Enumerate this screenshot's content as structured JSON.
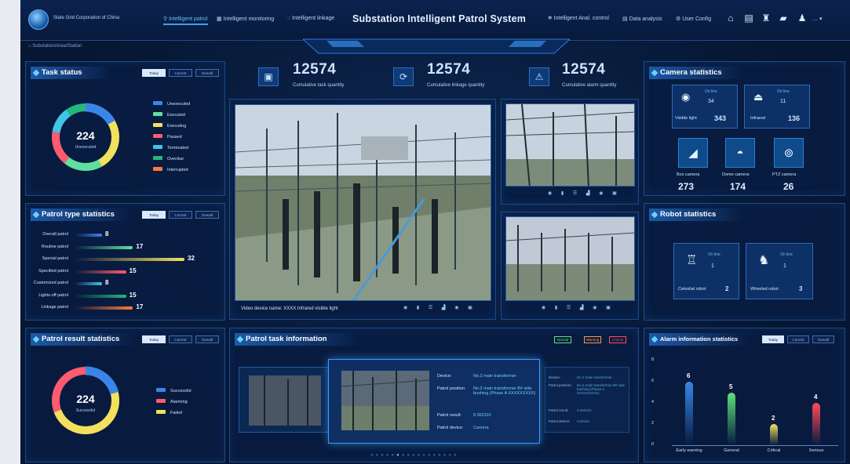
{
  "header": {
    "org": "State Grid Corporation of China",
    "system_title": "Substation Intelligent Patrol System",
    "user": "…",
    "nav_left": [
      {
        "label": "Intelligent patrol",
        "active": true
      },
      {
        "label": "Intelligent monitoring",
        "active": false
      },
      {
        "label": "Intelligent linkage",
        "active": false
      }
    ],
    "nav_right": [
      {
        "label": "Intelligent Anal. control"
      },
      {
        "label": "Data analysis"
      },
      {
        "label": "User Config"
      }
    ],
    "icons": [
      "home-icon",
      "document-icon",
      "robot-icon",
      "folder-icon",
      "user-icon"
    ]
  },
  "breadcrumb": "Substation/Area/Station",
  "task_status": {
    "title": "Task status",
    "tabs": [
      "Today",
      "Current",
      "Overall"
    ],
    "total": "224",
    "total_label": "Unexecuted",
    "legend": [
      {
        "label": "Unexecuted",
        "color": "#3a86e8"
      },
      {
        "label": "Executed",
        "color": "#5fe0a0"
      },
      {
        "label": "Executing",
        "color": "#f2e15c"
      },
      {
        "label": "Paused",
        "color": "#ff5a6e"
      },
      {
        "label": "Terminated",
        "color": "#3fc6e8"
      },
      {
        "label": "Overdue",
        "color": "#23b87a"
      },
      {
        "label": "Interrupted",
        "color": "#ff7a3c"
      }
    ]
  },
  "patrol_type": {
    "title": "Patrol type statistics",
    "tabs": [
      "Today",
      "Current",
      "Overall"
    ],
    "rows": [
      {
        "label": "Overall patrol",
        "value": 8,
        "color": "#3a86e8"
      },
      {
        "label": "Routine patrol",
        "value": 17,
        "color": "#5fe0a0"
      },
      {
        "label": "Special patrol",
        "value": 32,
        "color": "#f2e15c"
      },
      {
        "label": "Specified patrol",
        "value": 15,
        "color": "#ff5a6e"
      },
      {
        "label": "Customized patrol",
        "value": 8,
        "color": "#3fc6e8"
      },
      {
        "label": "Lights-off patrol",
        "value": 15,
        "color": "#23b87a"
      },
      {
        "label": "Linkage patrol",
        "value": 17,
        "color": "#ff7a3c"
      }
    ]
  },
  "patrol_result": {
    "title": "Patrol result statistics",
    "tabs": [
      "Today",
      "Current",
      "Overall"
    ],
    "total": "224",
    "total_label": "Successful",
    "legend": [
      {
        "label": "Successful",
        "color": "#3a86e8"
      },
      {
        "label": "Alarming",
        "color": "#ff5a6e"
      },
      {
        "label": "Failed",
        "color": "#f2e15c"
      }
    ]
  },
  "kpis": [
    {
      "value": "12574",
      "label": "Cumulative task quantity",
      "color": "#5fd8ff",
      "icon": "clipboard-icon"
    },
    {
      "value": "12574",
      "label": "Cumulative linkage quantity",
      "color": "#5fe07a",
      "icon": "refresh-icon"
    },
    {
      "value": "12574",
      "label": "Cumulative alarm quantity",
      "color": "#ff4a5a",
      "icon": "warning-icon"
    }
  ],
  "video": {
    "caption": "Video device name: XXXX Infrared visible light"
  },
  "patrol_task": {
    "title": "Patrol task information",
    "filters": [
      "Normal",
      "Warning",
      "Critical"
    ],
    "detail": {
      "device_k": "Device:",
      "device_v": "No.2 main transformer",
      "pos_k": "Patrol position:",
      "pos_v": "No.2 main transformer B# side bushing (Phase A XXXXXXXXX)",
      "result_k": "Patrol result:",
      "result_v": "0.352110",
      "pdev_k": "Patrol device:",
      "pdev_v": "Camera"
    },
    "detail2": {
      "device_k": "Device:",
      "device_v": "No.2 main transformer",
      "pos_k": "Patrol position:",
      "pos_v": "No.2 main transformer B# side bushing (Phase A XXXXXXXXX)",
      "result_k": "Patrol result:",
      "result_v": "0.352110",
      "pdev_k": "Patrol device:",
      "pdev_v": "Camera"
    }
  },
  "camera": {
    "title": "Camera statistics",
    "visible": {
      "label": "Visible light",
      "online_label": "On line",
      "online": "34",
      "total": "343"
    },
    "infrared": {
      "label": "Infrared",
      "online_label": "On line",
      "online": "11",
      "total": "136"
    },
    "types": [
      {
        "label": "Box camera",
        "value": "273",
        "icon": "box-camera-icon"
      },
      {
        "label": "Dome camera",
        "value": "174",
        "icon": "dome-camera-icon"
      },
      {
        "label": "PTZ camera",
        "value": "26",
        "icon": "ptz-camera-icon"
      }
    ]
  },
  "robot": {
    "title": "Robot statistics",
    "celestial": {
      "label": "Celestial robot",
      "online_label": "On line",
      "online": "1",
      "total": "2"
    },
    "wheeled": {
      "label": "Wheeled robot",
      "online_label": "On line",
      "online": "1",
      "total": "3"
    }
  },
  "alarm": {
    "title": "Alarm information statistics",
    "tabs": [
      "Today",
      "Current",
      "Overall"
    ],
    "yticks": [
      "0",
      "2",
      "4",
      "6",
      "8"
    ]
  },
  "chart_data": {
    "type": "bar",
    "categories": [
      "Early warning",
      "General",
      "Critical",
      "Serious"
    ],
    "values": [
      6,
      5,
      2,
      4
    ],
    "ylim": [
      0,
      8
    ],
    "colors": [
      "#3a86e8",
      "#5fe07a",
      "#f2e15c",
      "#ff4a5a"
    ]
  }
}
